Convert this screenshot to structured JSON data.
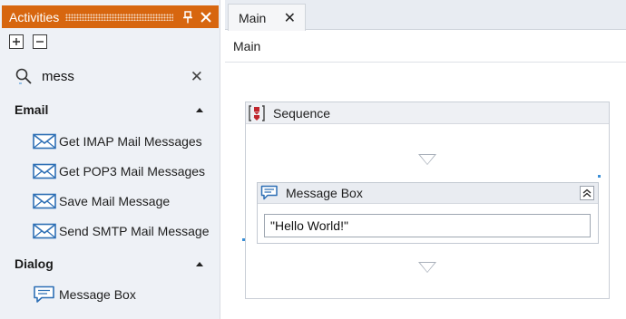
{
  "activities_panel": {
    "title": "Activities",
    "pin_icon": "pin-icon",
    "close_icon": "close-icon",
    "expand_all_icon": "expand-all-icon",
    "collapse_all_icon": "collapse-all-icon",
    "search": {
      "value": "mess",
      "icon": "search-icon",
      "clear_glyph": "✕"
    },
    "categories": [
      {
        "label": "Email",
        "items": [
          {
            "label": "Get IMAP Mail Messages",
            "icon": "envelope-icon"
          },
          {
            "label": "Get POP3 Mail Messages",
            "icon": "envelope-icon"
          },
          {
            "label": "Save Mail Message",
            "icon": "envelope-icon"
          },
          {
            "label": "Send SMTP Mail Message",
            "icon": "envelope-icon"
          }
        ]
      },
      {
        "label": "Dialog",
        "items": [
          {
            "label": "Message Box",
            "icon": "speech-bubble-icon"
          }
        ]
      }
    ]
  },
  "designer": {
    "tab": {
      "label": "Main",
      "close_glyph": "✕"
    },
    "breadcrumb": "Main",
    "sequence": {
      "title": "Sequence",
      "icon": "sequence-icon",
      "activity": {
        "title": "Message Box",
        "icon": "speech-bubble-icon",
        "text_value": "\"Hello World!\"",
        "collapse_icon": "double-chevron-up-icon"
      }
    }
  },
  "colors": {
    "accent_orange": "#d7660f",
    "panel_bg": "#eef1f6",
    "icon_blue": "#2d6fb5",
    "sequence_red": "#c0262d"
  }
}
